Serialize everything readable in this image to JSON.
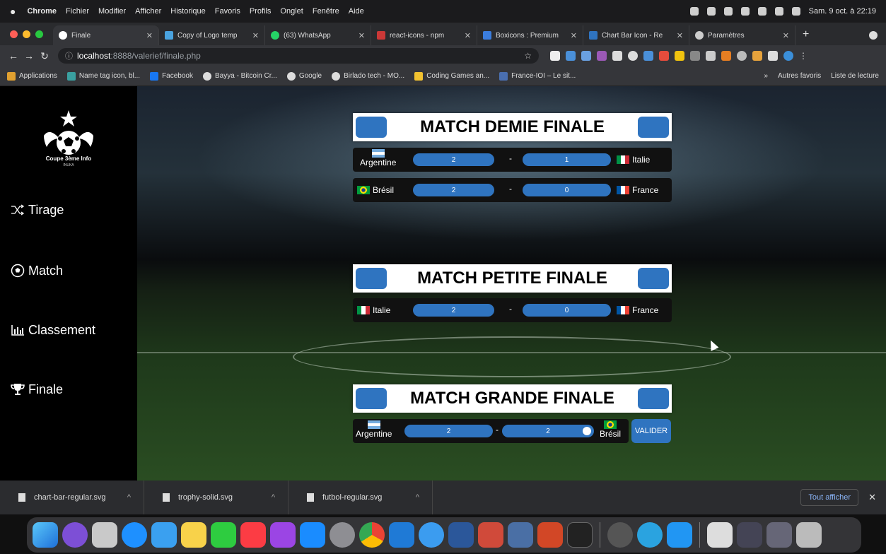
{
  "menubar": {
    "app": "Chrome",
    "items": [
      "Fichier",
      "Modifier",
      "Afficher",
      "Historique",
      "Favoris",
      "Profils",
      "Onglet",
      "Fenêtre",
      "Aide"
    ],
    "clock": "Sam. 9 oct. à 22:19"
  },
  "tabs": [
    {
      "label": "Finale",
      "color": "#ffffff"
    },
    {
      "label": "Copy of Logo temp",
      "color": "#4aa3df"
    },
    {
      "label": "(63) WhatsApp",
      "color": "#25d366"
    },
    {
      "label": "react-icons - npm",
      "color": "#cb3837"
    },
    {
      "label": "Boxicons : Premium",
      "color": "#3b7ddd"
    },
    {
      "label": "Chart Bar Icon - Re",
      "color": "#2f74c0"
    },
    {
      "label": "Paramètres",
      "color": "#cccccc"
    }
  ],
  "address": {
    "host": "localhost",
    "path": ":8888/valerief/finale.php"
  },
  "bookmarks": [
    {
      "label": "Applications",
      "color": "#e0a030"
    },
    {
      "label": "Name tag icon, bl...",
      "color": "#3aa0a0"
    },
    {
      "label": "Facebook",
      "color": "#1877f2"
    },
    {
      "label": "Bayya - Bitcoin Cr...",
      "color": "#dddddd"
    },
    {
      "label": "Google",
      "color": "#dddddd"
    },
    {
      "label": "Birlado tech - MO...",
      "color": "#dddddd"
    },
    {
      "label": "Coding Games an...",
      "color": "#f2c230"
    },
    {
      "label": "France-IOI – Le sit...",
      "color": "#4a6fb0"
    }
  ],
  "bookmarks_right": {
    "other": "Autres favoris",
    "reading": "Liste de lecture"
  },
  "sidebar": {
    "logo_title": "Coupe 3ème Info",
    "logo_sub": "INUKA",
    "items": [
      {
        "label": "Tirage",
        "icon": "shuffle-icon"
      },
      {
        "label": "Match",
        "icon": "futbol-icon"
      },
      {
        "label": "Classement",
        "icon": "chart-bar-icon"
      },
      {
        "label": "Finale",
        "icon": "trophy-icon"
      }
    ]
  },
  "semi": {
    "title": "MATCH DEMIE FINALE",
    "m1": {
      "home": "Argentine",
      "home_score": "2",
      "away_score": "1",
      "away": "Italie"
    },
    "m2": {
      "home": "Brésil",
      "home_score": "2",
      "away_score": "0",
      "away": "France"
    }
  },
  "third": {
    "title": "MATCH PETITE FINALE",
    "m1": {
      "home": "Italie",
      "home_score": "2",
      "away_score": "0",
      "away": "France"
    }
  },
  "final": {
    "title": "MATCH GRANDE FINALE",
    "m1": {
      "home": "Argentine",
      "home_score": "2",
      "away_score": "2",
      "away": "Brésil"
    },
    "validate": "VALIDER"
  },
  "dash": "-",
  "downloads": {
    "files": [
      "chart-bar-regular.svg",
      "trophy-solid.svg",
      "futbol-regular.svg"
    ],
    "show_all": "Tout afficher"
  },
  "colors": {
    "accent": "#2f74c0",
    "sidebar": "#000000"
  }
}
